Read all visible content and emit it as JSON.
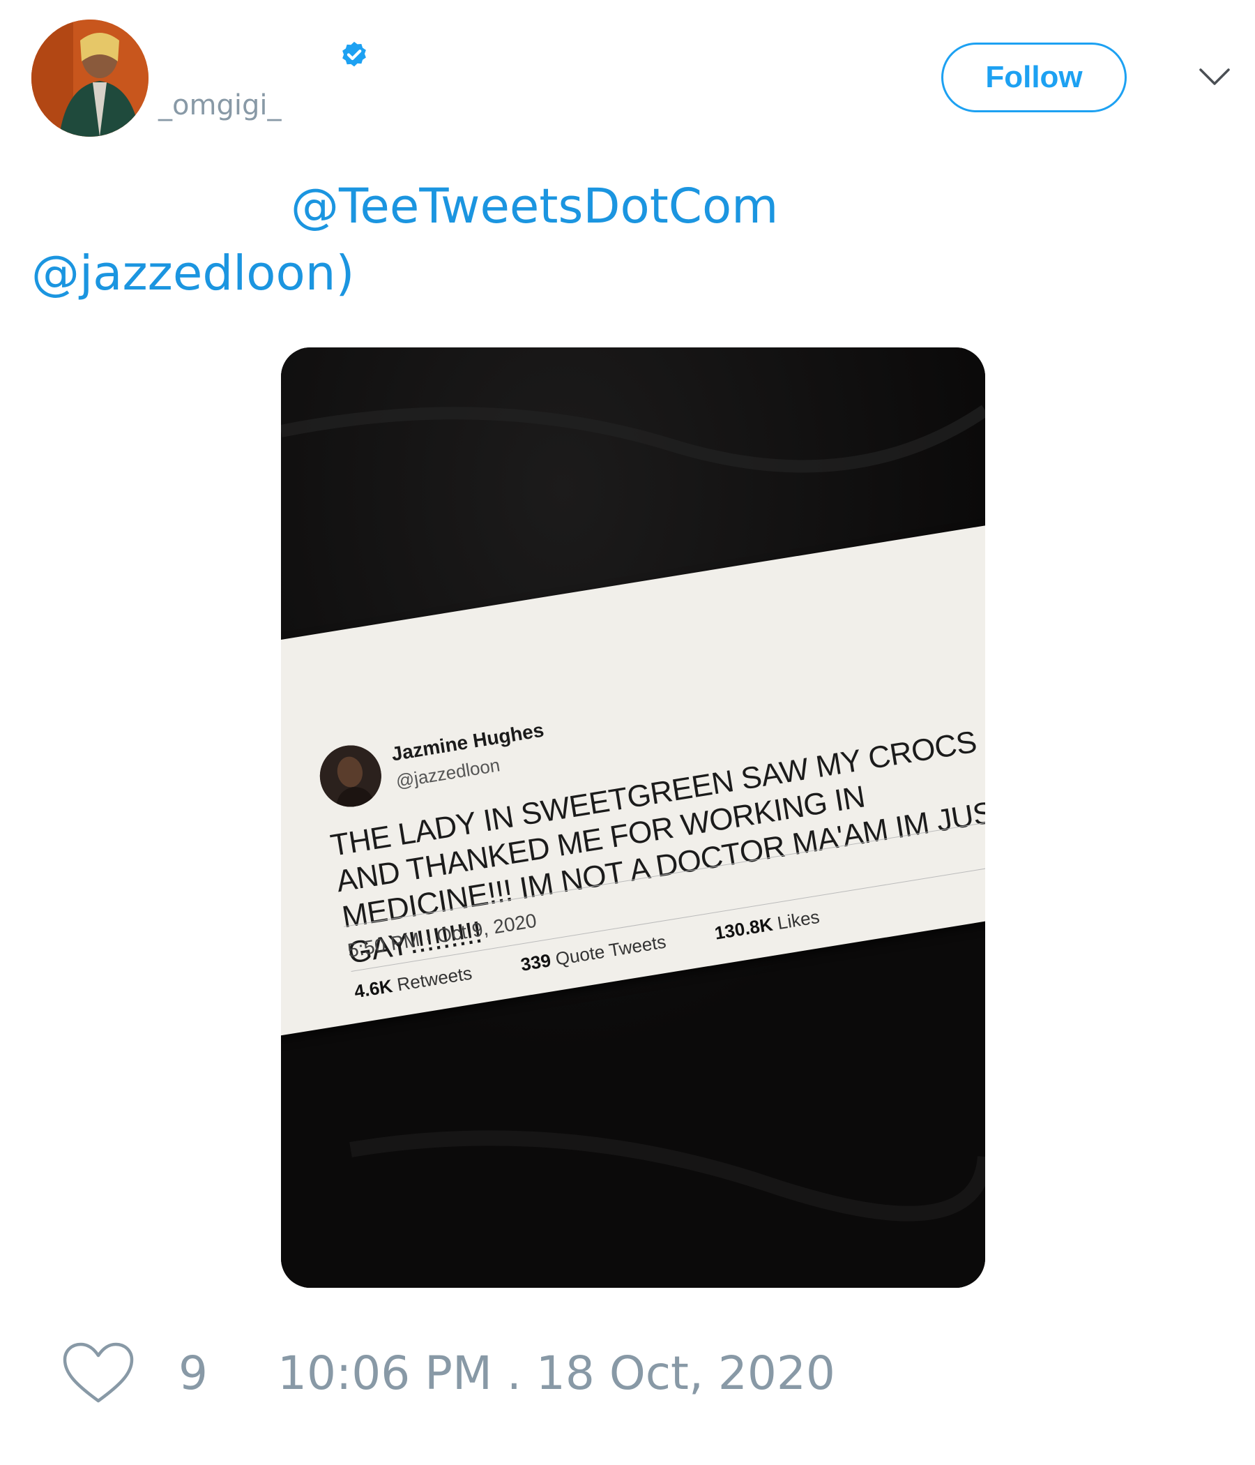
{
  "author": {
    "handle": "_omgigi_"
  },
  "actions": {
    "follow_label": "Follow"
  },
  "tweet": {
    "mention_1": "@TeeTweetsDotCom",
    "mention_2": "@jazzedloon)"
  },
  "embedded_screenshot": {
    "name": "Jazmine Hughes",
    "handle": "@jazzedloon",
    "body": "THE LADY IN SWEETGREEN SAW MY CROCS AND THANKED ME FOR WORKING IN MEDICINE!!! IM NOT A DOCTOR MA'AM IM JUST GAY!!!!!!!!!",
    "timestamp": "5:50 PM · Oct 9, 2020",
    "retweets_value": "4.6K",
    "retweets_label": "Retweets",
    "quotes_value": "339",
    "quotes_label": "Quote Tweets",
    "likes_value": "130.8K",
    "likes_label": "Likes"
  },
  "footer": {
    "like_count": "9",
    "timestamp": "10:06 PM . 18 Oct, 2020"
  },
  "icons": [
    "verified-badge-icon",
    "chevron-down-icon",
    "heart-icon"
  ],
  "colors": {
    "accent": "#1da1f2",
    "link": "#1b95e0",
    "muted": "#8899a6"
  }
}
